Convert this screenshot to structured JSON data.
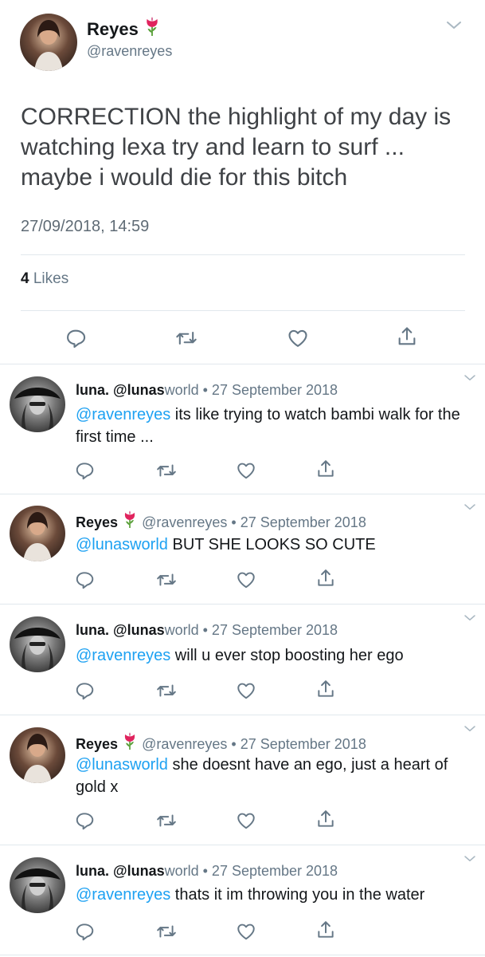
{
  "main": {
    "author_name": "Reyes",
    "author_handle": "@ravenreyes",
    "text": "CORRECTION the highlight of my day is watching lexa try and learn to surf ... maybe i would die for this bitch",
    "timestamp": "27/09/2018, 14:59",
    "likes_count": "4",
    "likes_label": "Likes"
  },
  "replies": [
    {
      "name": "luna.",
      "handle_bold": "@lunas",
      "handle_rest": "world",
      "date": " • 27 September 2018",
      "mention": "@ravenreyes",
      "text": " its like trying to watch bambi walk for the first time ..."
    },
    {
      "name": "Reyes",
      "handle": "@ravenreyes",
      "date": " • 27 September 2018",
      "mention": "@lunasworld",
      "text": " BUT SHE LOOKS SO CUTE"
    },
    {
      "name": "luna.",
      "handle_bold": "@lunas",
      "handle_rest": "world",
      "date": " • 27 September 2018",
      "mention": "@ravenreyes",
      "text": " will u ever stop boosting her ego"
    },
    {
      "name": "Reyes",
      "handle": "@ravenreyes",
      "date": " • 27 September 2018",
      "mention": "@lunasworld",
      "text": " she doesnt have an ego, just a heart of gold x"
    },
    {
      "name": "luna.",
      "handle_bold": "@lunas",
      "handle_rest": "world",
      "date": " • 27 September 2018",
      "mention": "@ravenreyes",
      "text": " thats it im throwing you in the water"
    }
  ],
  "colors": {
    "link": "#1da1f2",
    "muted": "#657786",
    "divider": "#e1e8ed",
    "tulip": "#e0245e"
  },
  "icons": {
    "reply": "reply-icon",
    "retweet": "retweet-icon",
    "like": "heart-icon",
    "share": "share-icon",
    "more": "chevron-down-icon",
    "emoji": "tulip-icon"
  }
}
